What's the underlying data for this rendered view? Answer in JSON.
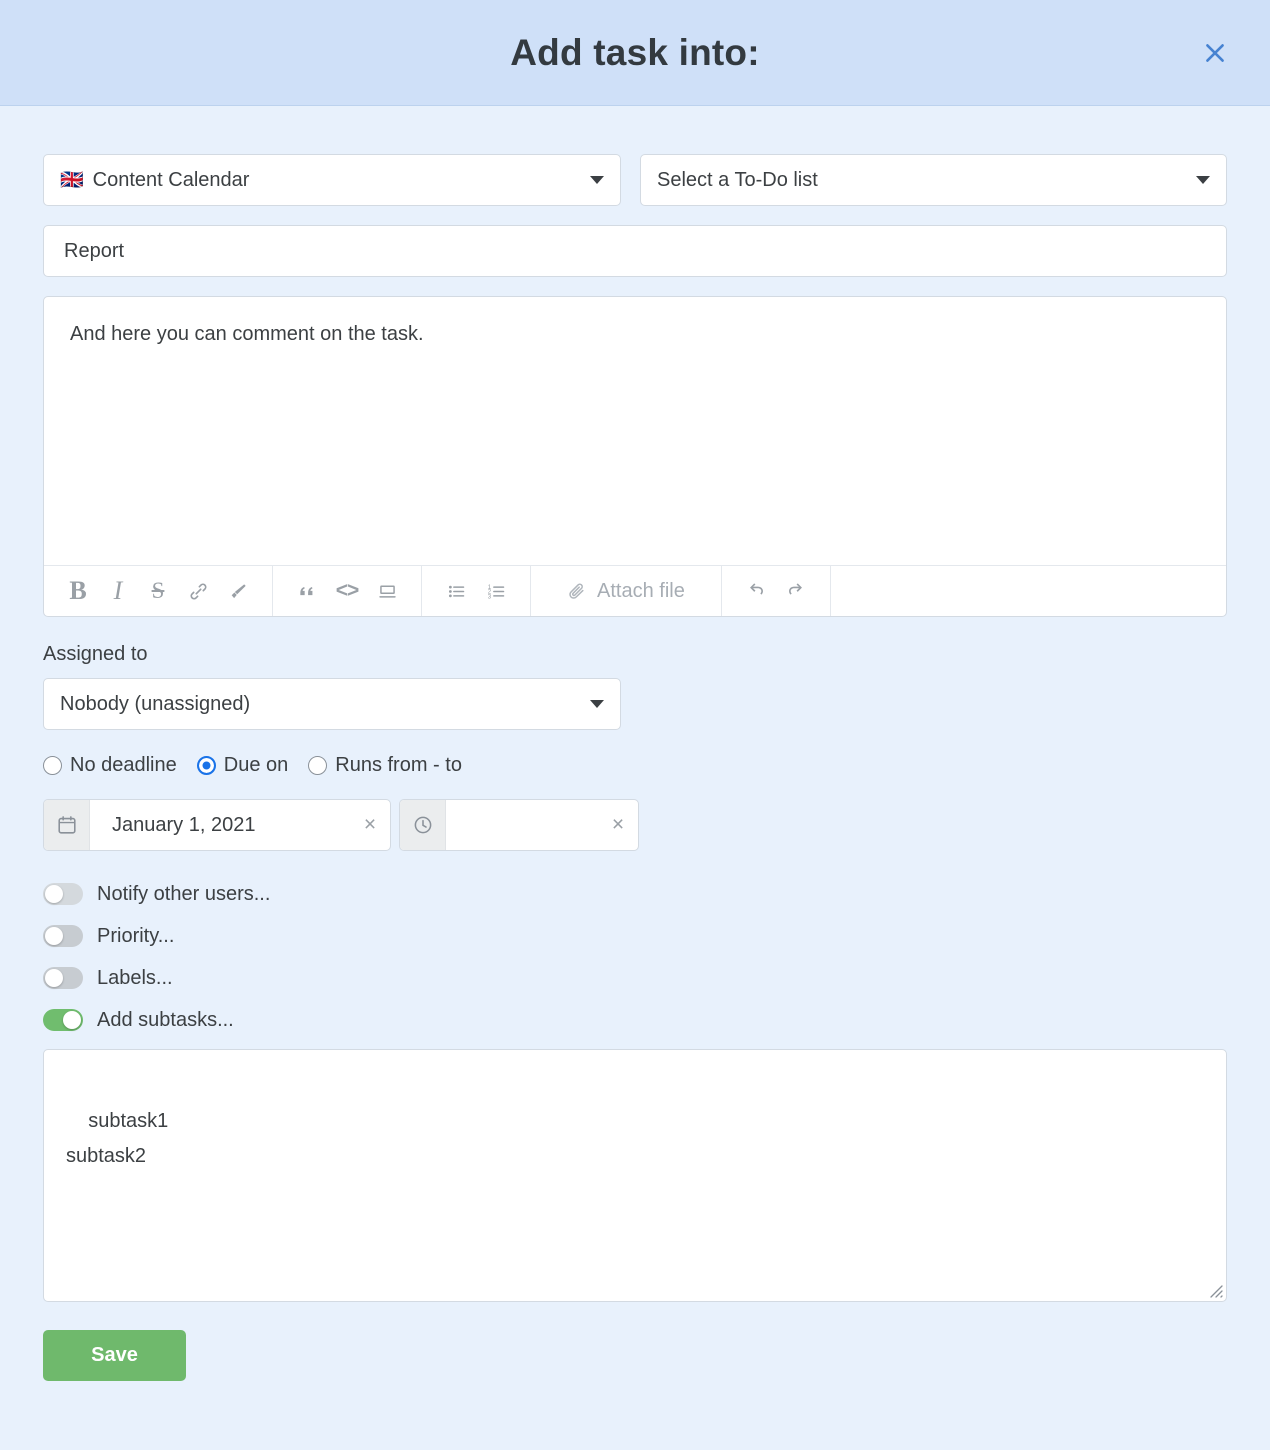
{
  "header": {
    "title": "Add task into:",
    "close_icon": "close-icon"
  },
  "selects": {
    "project": {
      "flag": "🇬🇧",
      "value": "Content Calendar"
    },
    "todo_list": {
      "value": "Select a To-Do list"
    },
    "assigned": {
      "label": "Assigned to",
      "value": "Nobody (unassigned)"
    }
  },
  "task": {
    "title_value": "Report",
    "description_value": "And here you can comment on the task."
  },
  "toolbar": {
    "bold": "B",
    "italic": "I",
    "strikethrough": "S",
    "link": "link-icon",
    "brush": "brush-icon",
    "quote": "“",
    "code": "<>",
    "divider": "divider-icon",
    "bullet_list": "bullet-list-icon",
    "numbered_list": "numbered-list-icon",
    "attach_label": "Attach file",
    "undo": "undo-icon",
    "redo": "redo-icon"
  },
  "deadline": {
    "options": [
      {
        "label": "No deadline",
        "selected": false
      },
      {
        "label": "Due on",
        "selected": true
      },
      {
        "label": "Runs from - to",
        "selected": false
      }
    ],
    "date_value": "January 1, 2021",
    "time_value": "",
    "clear_glyph": "×"
  },
  "toggles": [
    {
      "label": "Notify other users...",
      "on": false
    },
    {
      "label": "Priority...",
      "on": false
    },
    {
      "label": "Labels...",
      "on": false
    },
    {
      "label": "Add subtasks...",
      "on": true
    }
  ],
  "subtasks": {
    "value": "subtask1\nsubtask2"
  },
  "actions": {
    "save_label": "Save"
  },
  "colors": {
    "header_bg": "#cfe0f8",
    "body_bg": "#e8f1fc",
    "accent_blue": "#1a73e8",
    "save_green": "#6fb96c",
    "toggle_on_green": "#70bd6e"
  }
}
